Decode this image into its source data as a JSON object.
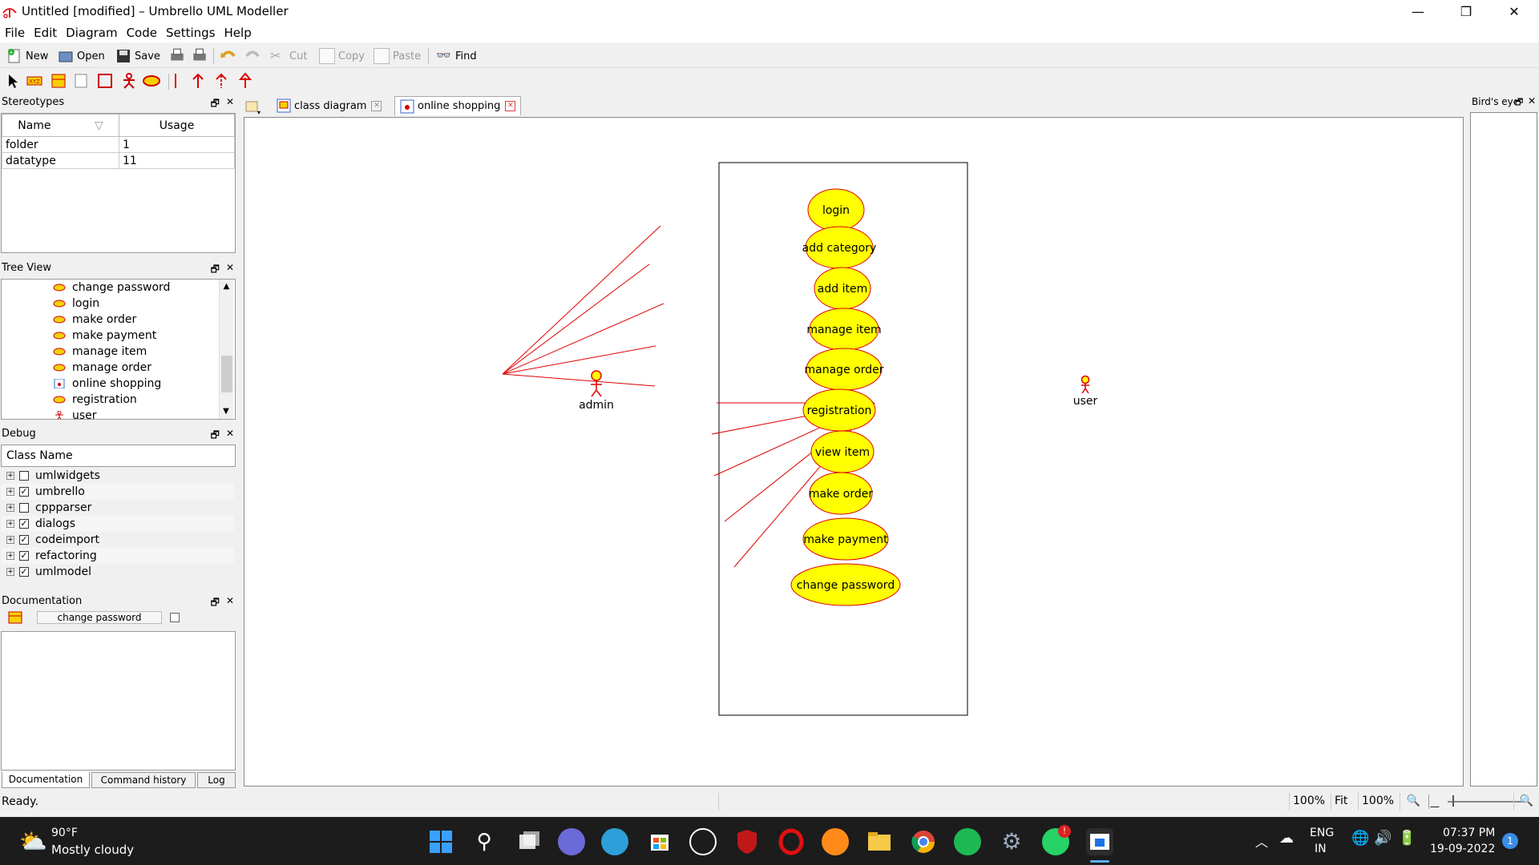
{
  "window": {
    "title": "Untitled [modified] – Umbrello UML Modeller",
    "minimize_glyph": "—",
    "restore_glyph": "❐",
    "close_glyph": "✕"
  },
  "menu": [
    "File",
    "Edit",
    "Diagram",
    "Code",
    "Settings",
    "Help"
  ],
  "toolbar": {
    "new": "New",
    "open": "Open",
    "save": "Save",
    "cut": "Cut",
    "copy": "Copy",
    "paste": "Paste",
    "find": "Find"
  },
  "stereotypes": {
    "title": "Stereotypes",
    "columns": [
      "Name",
      "Usage"
    ],
    "rows": [
      {
        "name": "folder",
        "usage": "1"
      },
      {
        "name": "datatype",
        "usage": "11"
      }
    ]
  },
  "tree_view": {
    "title": "Tree View",
    "items": [
      {
        "label": "change password",
        "icon": "usecase-icon"
      },
      {
        "label": "login",
        "icon": "usecase-icon"
      },
      {
        "label": "make order",
        "icon": "usecase-icon"
      },
      {
        "label": "make payment",
        "icon": "usecase-icon"
      },
      {
        "label": "manage item",
        "icon": "usecase-icon"
      },
      {
        "label": "manage order",
        "icon": "usecase-icon"
      },
      {
        "label": "online shopping",
        "icon": "diagram-icon"
      },
      {
        "label": "registration",
        "icon": "usecase-icon"
      },
      {
        "label": "user",
        "icon": "actor-icon"
      }
    ]
  },
  "debug": {
    "title": "Debug",
    "column": "Class Name",
    "rows": [
      {
        "name": "umlwidgets",
        "checked": false
      },
      {
        "name": "umbrello",
        "checked": true
      },
      {
        "name": "cppparser",
        "checked": false
      },
      {
        "name": "dialogs",
        "checked": true
      },
      {
        "name": "codeimport",
        "checked": true
      },
      {
        "name": "refactoring",
        "checked": true
      },
      {
        "name": "umlmodel",
        "checked": true
      }
    ]
  },
  "documentation": {
    "title": "Documentation",
    "field": "change password",
    "tabs": [
      "Documentation",
      "Command history",
      "Log"
    ]
  },
  "diagram_tabs": [
    {
      "label": "class diagram",
      "active": false
    },
    {
      "label": "online shopping",
      "active": true
    }
  ],
  "diagram": {
    "actors": [
      {
        "id": "admin",
        "label": "admin"
      },
      {
        "id": "user",
        "label": "user"
      }
    ],
    "use_cases": [
      {
        "label": "login"
      },
      {
        "label": "add category"
      },
      {
        "label": "add item"
      },
      {
        "label": "manage item"
      },
      {
        "label": "manage order"
      },
      {
        "label": "registration"
      },
      {
        "label": "view item"
      },
      {
        "label": "make order"
      },
      {
        "label": "make payment"
      },
      {
        "label": "change password"
      }
    ],
    "associations": [
      [
        "admin",
        "login"
      ],
      [
        "admin",
        "add category"
      ],
      [
        "admin",
        "add item"
      ],
      [
        "admin",
        "manage item"
      ],
      [
        "admin",
        "manage order"
      ],
      [
        "user",
        "registration"
      ],
      [
        "user",
        "view item"
      ],
      [
        "user",
        "make order"
      ],
      [
        "user",
        "make payment"
      ],
      [
        "user",
        "change password"
      ]
    ],
    "colors": {
      "usecase_fill": "#ffff00",
      "line": "#e00000"
    }
  },
  "birds_eye": {
    "title": "Bird's eye"
  },
  "status": {
    "text": "Ready.",
    "zoom1": "100%",
    "fit": "Fit",
    "zoom2": "100%"
  },
  "taskbar": {
    "weather_temp": "90°F",
    "weather_desc": "Mostly cloudy",
    "lang1": "ENG",
    "lang2": "IN",
    "time": "07:37 PM",
    "date": "19-09-2022",
    "notif_count": "1"
  }
}
